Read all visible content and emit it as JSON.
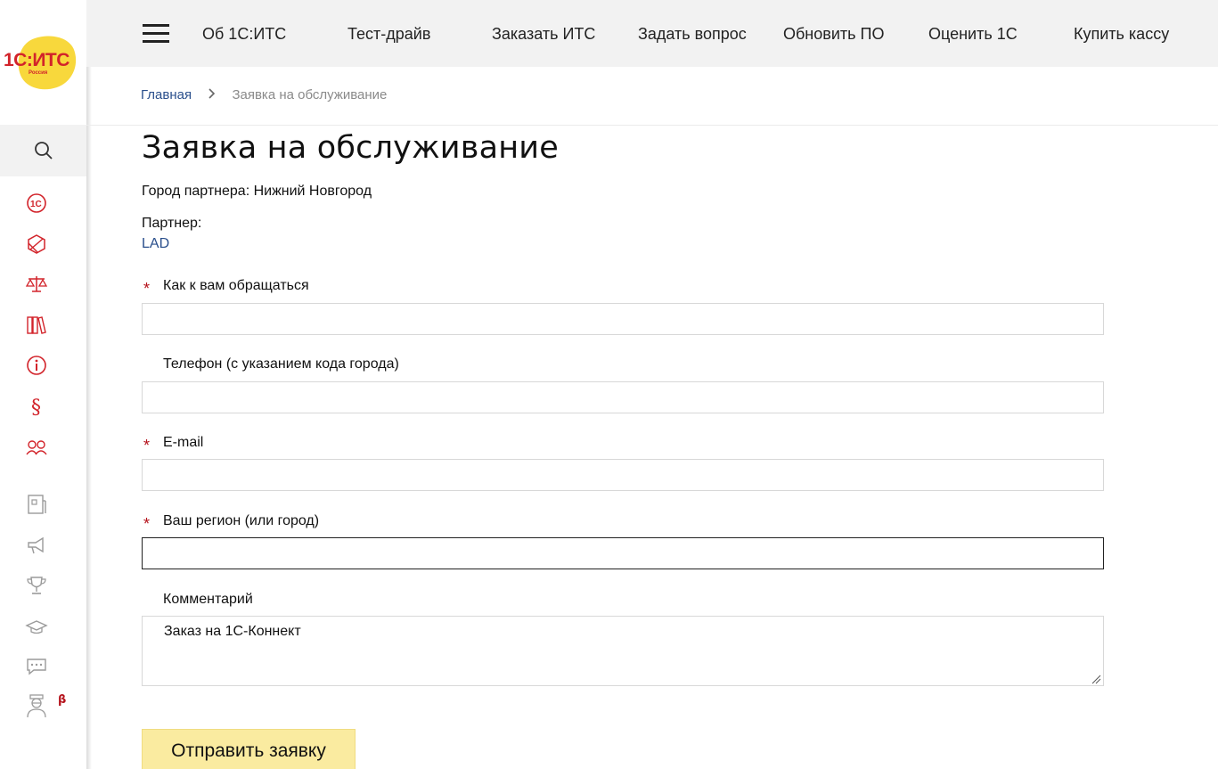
{
  "logo": {
    "text": "1С:ИТС",
    "subtitle": "Россия"
  },
  "nav": {
    "items": [
      "Об 1С:ИТС",
      "Тест-драйв",
      "Заказать ИТС",
      "Задать вопрос",
      "Обновить ПО",
      "Оценить 1С",
      "Купить кассу"
    ]
  },
  "breadcrumb": {
    "home": "Главная",
    "current": "Заявка на обслуживание"
  },
  "page": {
    "title": "Заявка на обслуживание",
    "city_line": "Город партнера: Нижний Новгород",
    "partner_label": "Партнер:",
    "partner_name": "LAD"
  },
  "form": {
    "name_label": "Как к вам обращаться",
    "name_value": "",
    "phone_label": "Телефон (с указанием кода города)",
    "phone_value": "",
    "email_label": "E-mail",
    "email_value": "",
    "region_label": "Ваш регион (или город)",
    "region_value": "",
    "comment_label": "Комментарий",
    "comment_value": "Заказ на 1С-Коннект",
    "required_mark": "*",
    "submit_label": "Отправить заявку"
  },
  "sidebar": {
    "beta_mark": "β",
    "icons": [
      "search-icon",
      "1c-icon",
      "cube-icon",
      "scales-icon",
      "books-icon",
      "info-icon",
      "paragraph-icon",
      "people-icon",
      "news-icon",
      "megaphone-icon",
      "trophy-icon",
      "graduation-cap-icon",
      "chat-icon",
      "assistant-icon"
    ]
  },
  "colors": {
    "accent_red": "#b5121b",
    "link_blue": "#2a4f8c",
    "button_yellow": "#faeba0",
    "nav_bg": "#f2f2f2"
  }
}
